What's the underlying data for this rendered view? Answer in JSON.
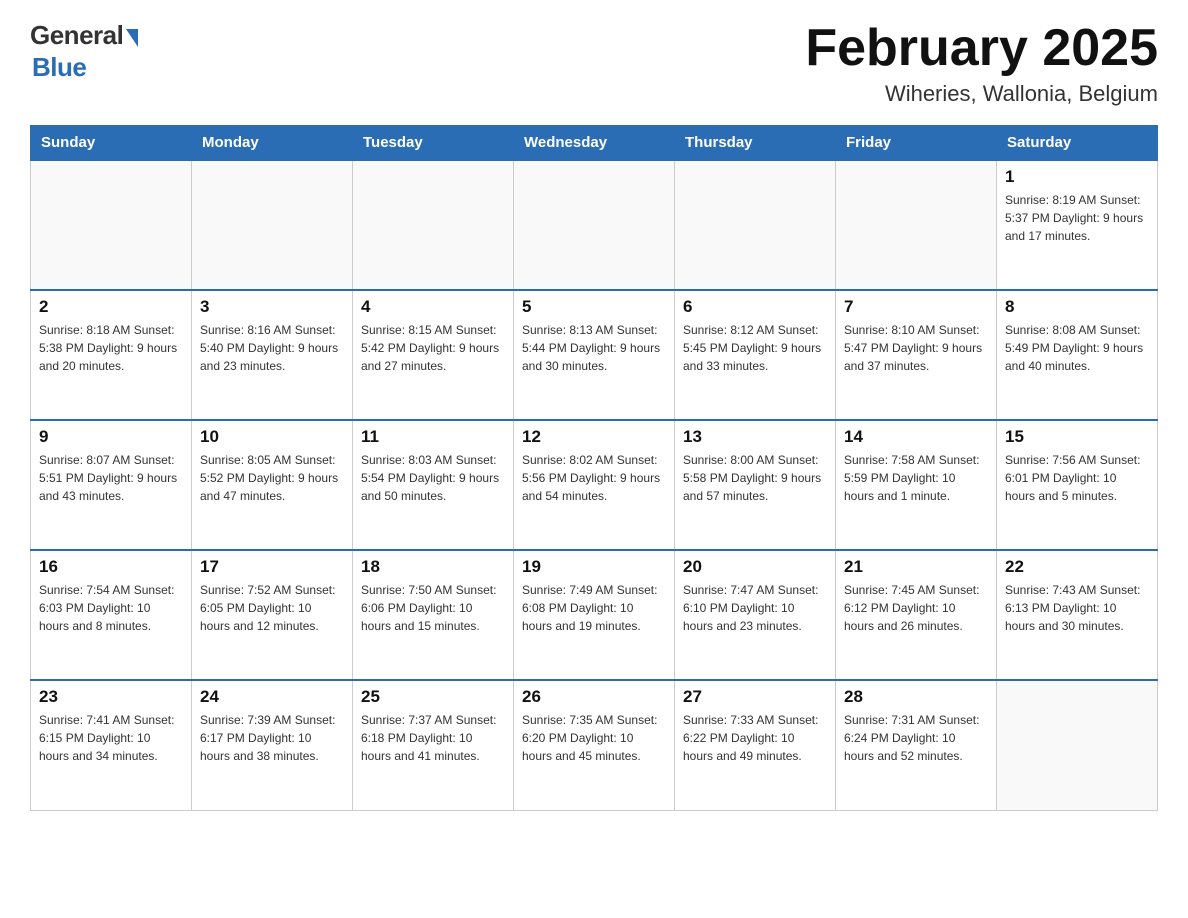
{
  "header": {
    "logo": {
      "general": "General",
      "blue": "Blue"
    },
    "title": "February 2025",
    "subtitle": "Wiheries, Wallonia, Belgium"
  },
  "calendar": {
    "days_of_week": [
      "Sunday",
      "Monday",
      "Tuesday",
      "Wednesday",
      "Thursday",
      "Friday",
      "Saturday"
    ],
    "weeks": [
      [
        {
          "day": "",
          "info": ""
        },
        {
          "day": "",
          "info": ""
        },
        {
          "day": "",
          "info": ""
        },
        {
          "day": "",
          "info": ""
        },
        {
          "day": "",
          "info": ""
        },
        {
          "day": "",
          "info": ""
        },
        {
          "day": "1",
          "info": "Sunrise: 8:19 AM\nSunset: 5:37 PM\nDaylight: 9 hours and 17 minutes."
        }
      ],
      [
        {
          "day": "2",
          "info": "Sunrise: 8:18 AM\nSunset: 5:38 PM\nDaylight: 9 hours and 20 minutes."
        },
        {
          "day": "3",
          "info": "Sunrise: 8:16 AM\nSunset: 5:40 PM\nDaylight: 9 hours and 23 minutes."
        },
        {
          "day": "4",
          "info": "Sunrise: 8:15 AM\nSunset: 5:42 PM\nDaylight: 9 hours and 27 minutes."
        },
        {
          "day": "5",
          "info": "Sunrise: 8:13 AM\nSunset: 5:44 PM\nDaylight: 9 hours and 30 minutes."
        },
        {
          "day": "6",
          "info": "Sunrise: 8:12 AM\nSunset: 5:45 PM\nDaylight: 9 hours and 33 minutes."
        },
        {
          "day": "7",
          "info": "Sunrise: 8:10 AM\nSunset: 5:47 PM\nDaylight: 9 hours and 37 minutes."
        },
        {
          "day": "8",
          "info": "Sunrise: 8:08 AM\nSunset: 5:49 PM\nDaylight: 9 hours and 40 minutes."
        }
      ],
      [
        {
          "day": "9",
          "info": "Sunrise: 8:07 AM\nSunset: 5:51 PM\nDaylight: 9 hours and 43 minutes."
        },
        {
          "day": "10",
          "info": "Sunrise: 8:05 AM\nSunset: 5:52 PM\nDaylight: 9 hours and 47 minutes."
        },
        {
          "day": "11",
          "info": "Sunrise: 8:03 AM\nSunset: 5:54 PM\nDaylight: 9 hours and 50 minutes."
        },
        {
          "day": "12",
          "info": "Sunrise: 8:02 AM\nSunset: 5:56 PM\nDaylight: 9 hours and 54 minutes."
        },
        {
          "day": "13",
          "info": "Sunrise: 8:00 AM\nSunset: 5:58 PM\nDaylight: 9 hours and 57 minutes."
        },
        {
          "day": "14",
          "info": "Sunrise: 7:58 AM\nSunset: 5:59 PM\nDaylight: 10 hours and 1 minute."
        },
        {
          "day": "15",
          "info": "Sunrise: 7:56 AM\nSunset: 6:01 PM\nDaylight: 10 hours and 5 minutes."
        }
      ],
      [
        {
          "day": "16",
          "info": "Sunrise: 7:54 AM\nSunset: 6:03 PM\nDaylight: 10 hours and 8 minutes."
        },
        {
          "day": "17",
          "info": "Sunrise: 7:52 AM\nSunset: 6:05 PM\nDaylight: 10 hours and 12 minutes."
        },
        {
          "day": "18",
          "info": "Sunrise: 7:50 AM\nSunset: 6:06 PM\nDaylight: 10 hours and 15 minutes."
        },
        {
          "day": "19",
          "info": "Sunrise: 7:49 AM\nSunset: 6:08 PM\nDaylight: 10 hours and 19 minutes."
        },
        {
          "day": "20",
          "info": "Sunrise: 7:47 AM\nSunset: 6:10 PM\nDaylight: 10 hours and 23 minutes."
        },
        {
          "day": "21",
          "info": "Sunrise: 7:45 AM\nSunset: 6:12 PM\nDaylight: 10 hours and 26 minutes."
        },
        {
          "day": "22",
          "info": "Sunrise: 7:43 AM\nSunset: 6:13 PM\nDaylight: 10 hours and 30 minutes."
        }
      ],
      [
        {
          "day": "23",
          "info": "Sunrise: 7:41 AM\nSunset: 6:15 PM\nDaylight: 10 hours and 34 minutes."
        },
        {
          "day": "24",
          "info": "Sunrise: 7:39 AM\nSunset: 6:17 PM\nDaylight: 10 hours and 38 minutes."
        },
        {
          "day": "25",
          "info": "Sunrise: 7:37 AM\nSunset: 6:18 PM\nDaylight: 10 hours and 41 minutes."
        },
        {
          "day": "26",
          "info": "Sunrise: 7:35 AM\nSunset: 6:20 PM\nDaylight: 10 hours and 45 minutes."
        },
        {
          "day": "27",
          "info": "Sunrise: 7:33 AM\nSunset: 6:22 PM\nDaylight: 10 hours and 49 minutes."
        },
        {
          "day": "28",
          "info": "Sunrise: 7:31 AM\nSunset: 6:24 PM\nDaylight: 10 hours and 52 minutes."
        },
        {
          "day": "",
          "info": ""
        }
      ]
    ]
  }
}
